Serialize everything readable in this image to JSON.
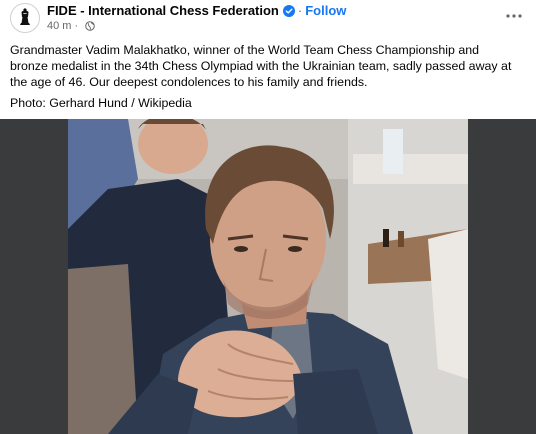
{
  "post": {
    "page_name": "FIDE - International Chess Federation",
    "separator": "·",
    "follow_label": "Follow",
    "timestamp": "40 m",
    "meta_separator": "·",
    "text": "Grandmaster Vadim Malakhatko, winner of the World Team Chess Championship and bronze medalist in the 34th Chess Olympiad with the Ukrainian team, sadly passed away at the age of 46. Our deepest condolences to his family and friends.",
    "photo_credit": "Photo: Gerhard Hund / Wikipedia"
  },
  "icons": {
    "avatar": "fide-logo-icon",
    "verified": "verified-badge-icon",
    "privacy": "globe-icon",
    "more": "more-options-icon"
  },
  "colors": {
    "link": "#1877f2",
    "secondary_text": "#65676b",
    "photo_background": "#3a3b3c"
  }
}
